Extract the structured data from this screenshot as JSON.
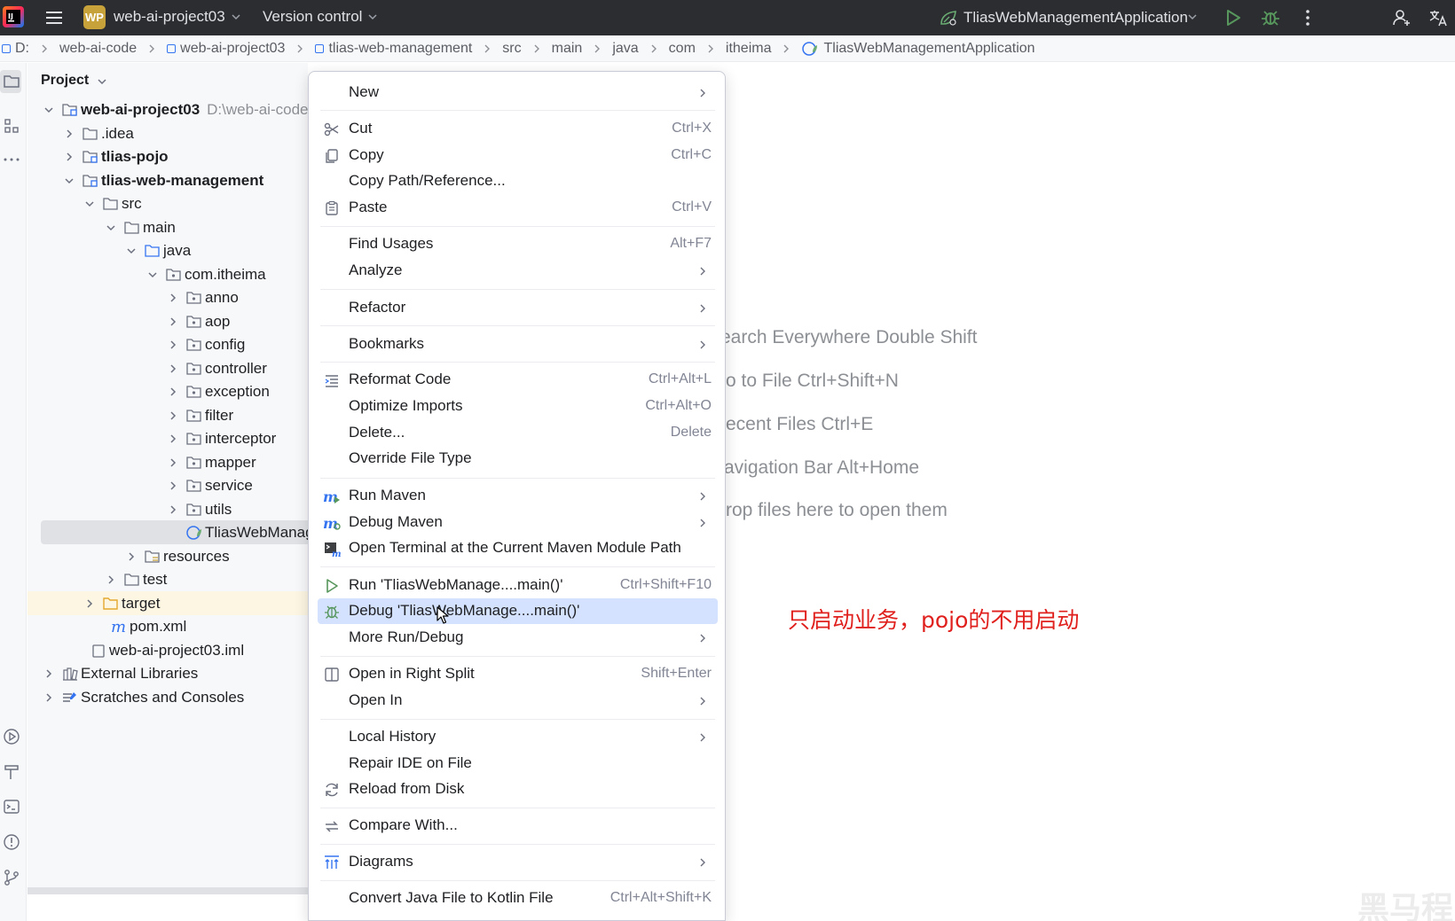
{
  "titlebar": {
    "project_badge": "WP",
    "project_name": "web-ai-project03",
    "version_control": "Version control",
    "run_config": "TliasWebManagementApplication"
  },
  "breadcrumb": [
    "D:",
    "web-ai-code",
    "web-ai-project03",
    "tlias-web-management",
    "src",
    "main",
    "java",
    "com",
    "itheima",
    "TliasWebManagementApplication"
  ],
  "project_panel": {
    "title": "Project",
    "root_path": "D:\\web-ai-code",
    "items": [
      {
        "label": "web-ai-project03"
      },
      {
        "label": ".idea"
      },
      {
        "label": "tlias-pojo"
      },
      {
        "label": "tlias-web-management"
      },
      {
        "label": "src"
      },
      {
        "label": "main"
      },
      {
        "label": "java"
      },
      {
        "label": "com.itheima"
      },
      {
        "label": "anno"
      },
      {
        "label": "aop"
      },
      {
        "label": "config"
      },
      {
        "label": "controller"
      },
      {
        "label": "exception"
      },
      {
        "label": "filter"
      },
      {
        "label": "interceptor"
      },
      {
        "label": "mapper"
      },
      {
        "label": "service"
      },
      {
        "label": "utils"
      },
      {
        "label": "TliasWebManagementApplication"
      },
      {
        "label": "resources"
      },
      {
        "label": "test"
      },
      {
        "label": "target"
      },
      {
        "label": "pom.xml"
      },
      {
        "label": "web-ai-project03.iml"
      },
      {
        "label": "External Libraries"
      },
      {
        "label": "Scratches and Consoles"
      }
    ]
  },
  "context_menu": {
    "items": [
      {
        "label": "New"
      },
      {
        "label": "Cut",
        "shortcut": "Ctrl+X"
      },
      {
        "label": "Copy",
        "shortcut": "Ctrl+C"
      },
      {
        "label": "Copy Path/Reference..."
      },
      {
        "label": "Paste",
        "shortcut": "Ctrl+V"
      },
      {
        "label": "Find Usages",
        "shortcut": "Alt+F7"
      },
      {
        "label": "Analyze"
      },
      {
        "label": "Refactor"
      },
      {
        "label": "Bookmarks"
      },
      {
        "label": "Reformat Code",
        "shortcut": "Ctrl+Alt+L"
      },
      {
        "label": "Optimize Imports",
        "shortcut": "Ctrl+Alt+O"
      },
      {
        "label": "Delete...",
        "shortcut": "Delete"
      },
      {
        "label": "Override File Type"
      },
      {
        "label": "Run Maven"
      },
      {
        "label": "Debug Maven"
      },
      {
        "label": "Open Terminal at the Current Maven Module Path"
      },
      {
        "label": "Run 'TliasWebManage....main()'",
        "shortcut": "Ctrl+Shift+F10"
      },
      {
        "label": "Debug 'TliasWebManage....main()'"
      },
      {
        "label": "More Run/Debug"
      },
      {
        "label": "Open in Right Split",
        "shortcut": "Shift+Enter"
      },
      {
        "label": "Open In"
      },
      {
        "label": "Local History"
      },
      {
        "label": "Repair IDE on File"
      },
      {
        "label": "Reload from Disk"
      },
      {
        "label": "Compare With..."
      },
      {
        "label": "Diagrams"
      },
      {
        "label": "Convert Java File to Kotlin File",
        "shortcut": "Ctrl+Alt+Shift+K"
      }
    ]
  },
  "editor_hints": [
    "earch Everywhere Double Shift",
    "o to File Ctrl+Shift+N",
    "ecent Files Ctrl+E",
    "avigation Bar Alt+Home",
    "rop files here to open them"
  ],
  "annotation": "只启动业务，pojo的不用启动",
  "colors": {
    "titlebar_bg": "#2b2d30",
    "accent": "#3574f0",
    "menu_highlight": "#d4e2ff",
    "annotation": "#e0201d"
  }
}
